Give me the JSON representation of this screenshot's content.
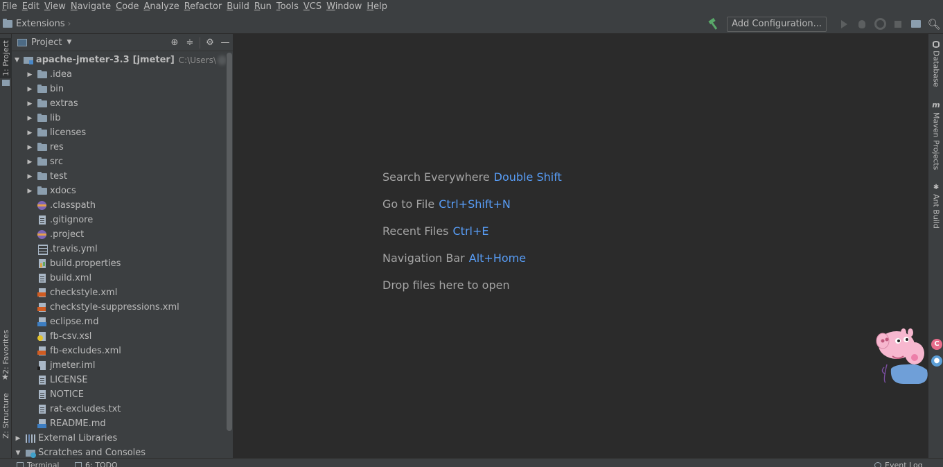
{
  "menu": [
    "File",
    "Edit",
    "View",
    "Navigate",
    "Code",
    "Analyze",
    "Refactor",
    "Build",
    "Run",
    "Tools",
    "VCS",
    "Window",
    "Help"
  ],
  "navbar": {
    "breadcrumb": "Extensions",
    "add_configuration": "Add Configuration..."
  },
  "left_strip": {
    "project_tab": "1: Project",
    "favorites_tab": "2: Favorites",
    "structure_tab": "Z: Structure"
  },
  "project_panel": {
    "title": "Project",
    "root": {
      "name": "apache-jmeter-3.3",
      "module": "[jmeter]",
      "path": "C:\\Users\\"
    },
    "folders": [
      ".idea",
      "bin",
      "extras",
      "lib",
      "licenses",
      "res",
      "src",
      "test",
      "xdocs"
    ],
    "files": [
      {
        "name": ".classpath",
        "icon": "eclipse-file-icon"
      },
      {
        "name": ".gitignore",
        "icon": "text-file-icon"
      },
      {
        "name": ".project",
        "icon": "eclipse-file-icon"
      },
      {
        "name": ".travis.yml",
        "icon": "yml-file-icon"
      },
      {
        "name": "build.properties",
        "icon": "properties-file-icon"
      },
      {
        "name": "build.xml",
        "icon": "ant-build-file-icon"
      },
      {
        "name": "checkstyle.xml",
        "icon": "xml-file-icon"
      },
      {
        "name": "checkstyle-suppressions.xml",
        "icon": "xml-file-icon"
      },
      {
        "name": "eclipse.md",
        "icon": "markdown-file-icon"
      },
      {
        "name": "fb-csv.xsl",
        "icon": "xsl-file-icon"
      },
      {
        "name": "fb-excludes.xml",
        "icon": "xml-file-icon"
      },
      {
        "name": "jmeter.iml",
        "icon": "iml-file-icon"
      },
      {
        "name": "LICENSE",
        "icon": "text-file-icon"
      },
      {
        "name": "NOTICE",
        "icon": "text-file-icon"
      },
      {
        "name": "rat-excludes.txt",
        "icon": "text-file-icon"
      },
      {
        "name": "README.md",
        "icon": "markdown-file-icon"
      }
    ],
    "external_libraries": "External Libraries",
    "scratches": "Scratches and Consoles"
  },
  "editor": {
    "hints": [
      {
        "label": "Search Everywhere",
        "key": "Double Shift"
      },
      {
        "label": "Go to File",
        "key": "Ctrl+Shift+N"
      },
      {
        "label": "Recent Files",
        "key": "Ctrl+E"
      },
      {
        "label": "Navigation Bar",
        "key": "Alt+Home"
      },
      {
        "label": "Drop files here to open",
        "key": ""
      }
    ]
  },
  "right_strip": {
    "database": "Database",
    "maven": "Maven Projects",
    "ant": "Ant Build"
  },
  "bottom_bar": {
    "terminal": "Terminal",
    "todo": "6: TODO",
    "event_log": "Event Log"
  },
  "colors": {
    "background": "#2b2b2b",
    "panel": "#3c3f41",
    "text": "#bbbbbb",
    "hint_key": "#589df6"
  }
}
